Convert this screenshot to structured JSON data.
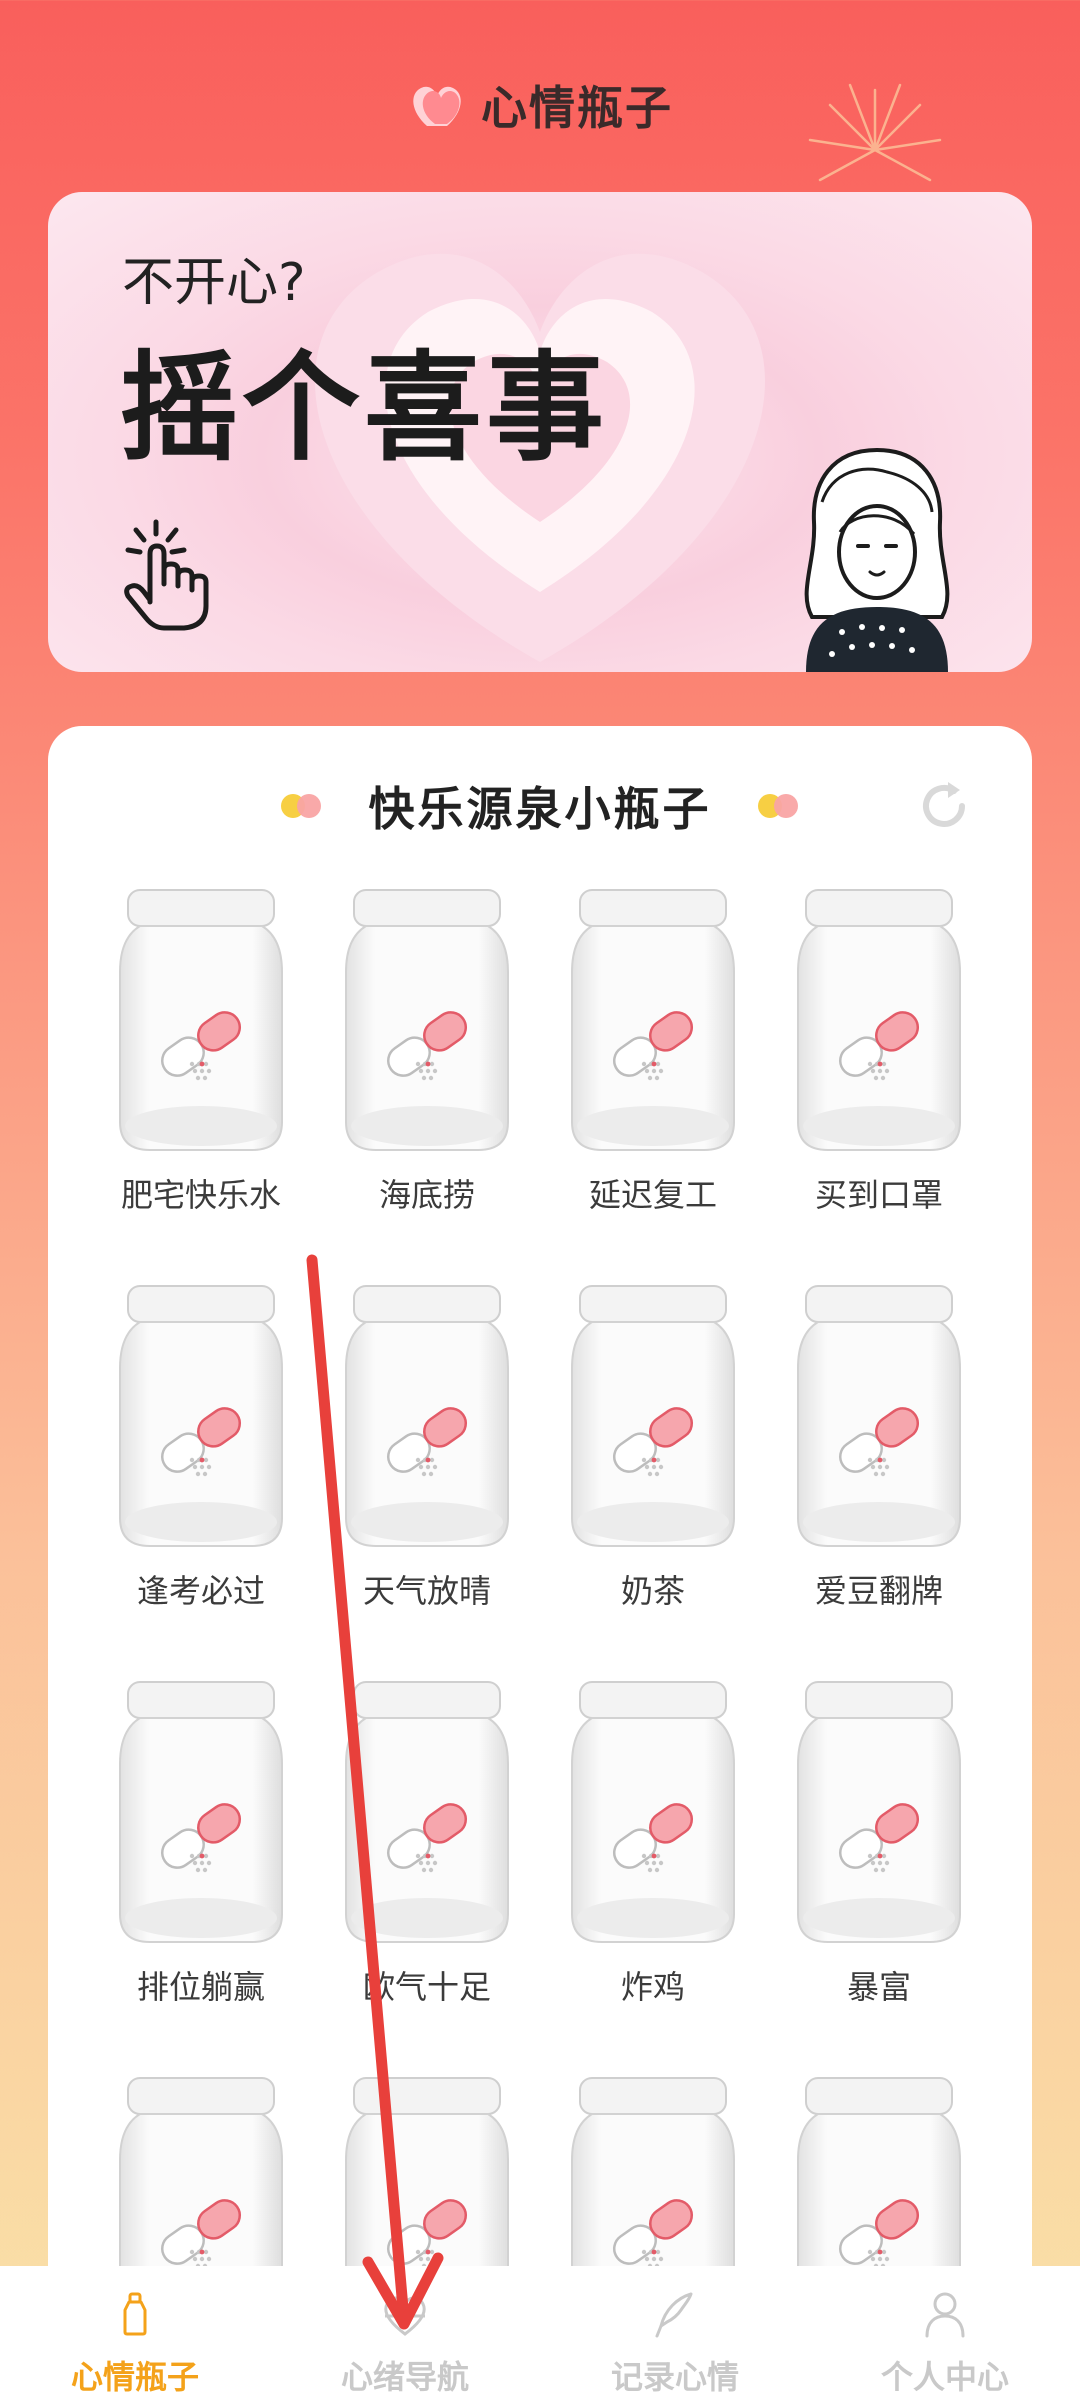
{
  "header": {
    "title": "心情瓶子",
    "icon": "heart-logo-icon"
  },
  "banner": {
    "subtitle": "不开心?",
    "headline": "摇个喜事"
  },
  "card": {
    "title": "快乐源泉小瓶子",
    "refresh_icon": "refresh-icon"
  },
  "jars": [
    {
      "label": "肥宅快乐水"
    },
    {
      "label": "海底捞"
    },
    {
      "label": "延迟复工"
    },
    {
      "label": "买到口罩"
    },
    {
      "label": "逢考必过"
    },
    {
      "label": "天气放晴"
    },
    {
      "label": "奶茶"
    },
    {
      "label": "爱豆翻牌"
    },
    {
      "label": "排位躺赢"
    },
    {
      "label": "欧气十足"
    },
    {
      "label": "炸鸡"
    },
    {
      "label": "暴富"
    },
    {
      "label": ""
    },
    {
      "label": ""
    },
    {
      "label": ""
    },
    {
      "label": ""
    }
  ],
  "tabs": [
    {
      "label": "心情瓶子",
      "icon": "bottle-icon",
      "active": true
    },
    {
      "label": "心绪导航",
      "icon": "heartbeat-icon",
      "active": false
    },
    {
      "label": "记录心情",
      "icon": "quill-icon",
      "active": false
    },
    {
      "label": "个人中心",
      "icon": "person-icon",
      "active": false
    }
  ],
  "colors": {
    "accent": "#f4a21a",
    "tab_inactive": "#c9c9c9",
    "annotation_arrow": "#e8403b"
  }
}
